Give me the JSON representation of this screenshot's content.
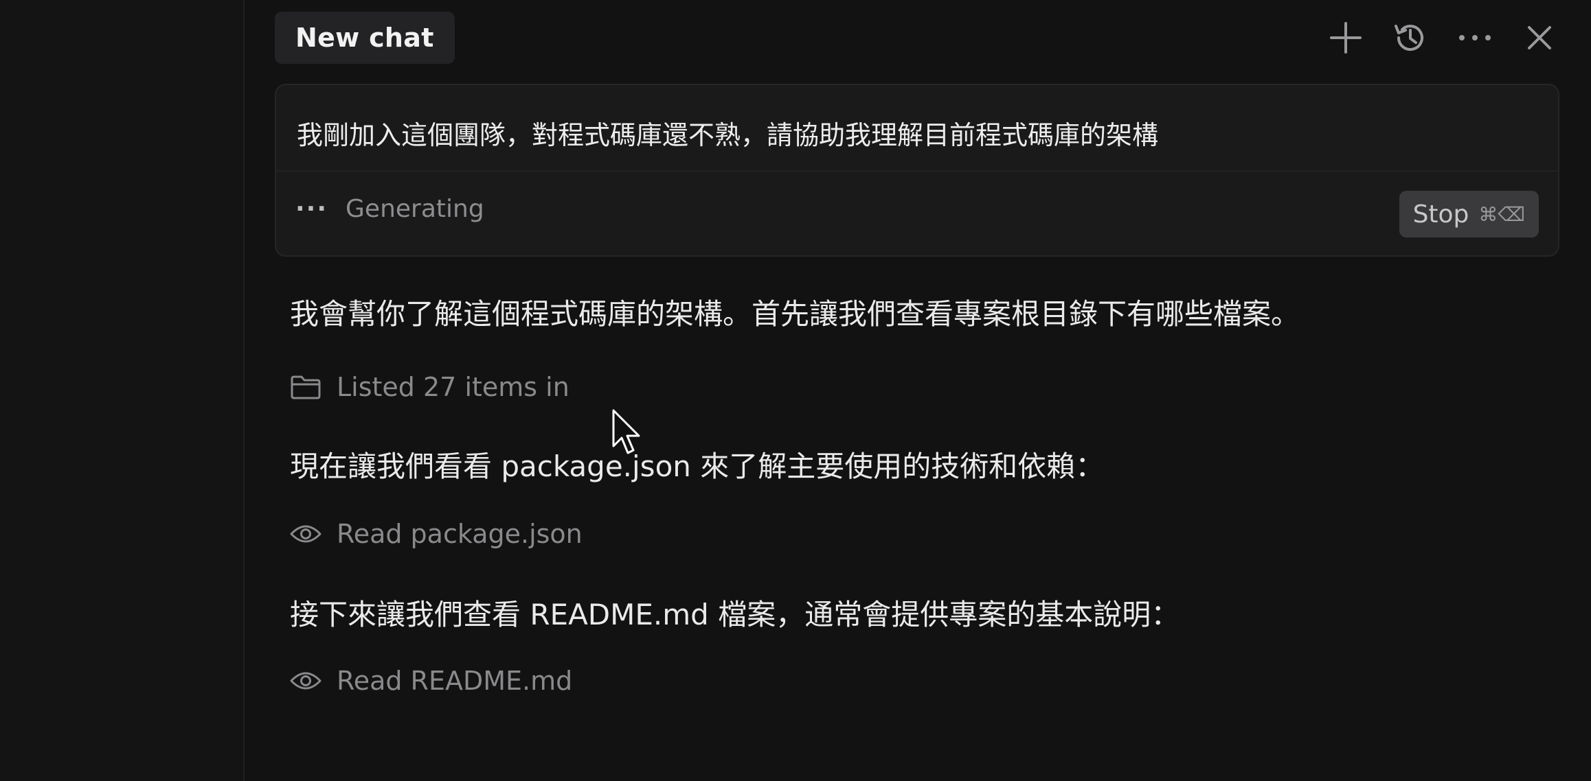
{
  "header": {
    "tab_label": "New chat",
    "icons": [
      "plus-icon",
      "history-icon",
      "more-icon",
      "close-icon"
    ]
  },
  "prompt": {
    "text": "我剛加入這個團隊，對程式碼庫還不熟，請協助我理解目前程式碼庫的架構",
    "status_dots": "···",
    "status_text": "Generating",
    "stop_label": "Stop",
    "stop_shortcut": "⌘⌫"
  },
  "messages": [
    {
      "type": "text",
      "text": "我會幫你了解這個程式碼庫的架構。首先讓我們查看專案根目錄下有哪些檔案。"
    },
    {
      "type": "tool",
      "icon": "folder-icon",
      "text": "Listed 27 items in"
    },
    {
      "type": "text",
      "text": "現在讓我們看看 package.json 來了解主要使用的技術和依賴："
    },
    {
      "type": "tool",
      "icon": "eye-icon",
      "text": "Read package.json"
    },
    {
      "type": "text",
      "text": "接下來讓我們查看 README.md 檔案，通常會提供專案的基本說明："
    },
    {
      "type": "tool",
      "icon": "eye-icon",
      "text": "Read README.md"
    }
  ],
  "colors": {
    "background": "#121213",
    "panel": "#1a1a1b",
    "stop_button": "#3a3a3c",
    "muted_text": "#8a8a8c"
  }
}
